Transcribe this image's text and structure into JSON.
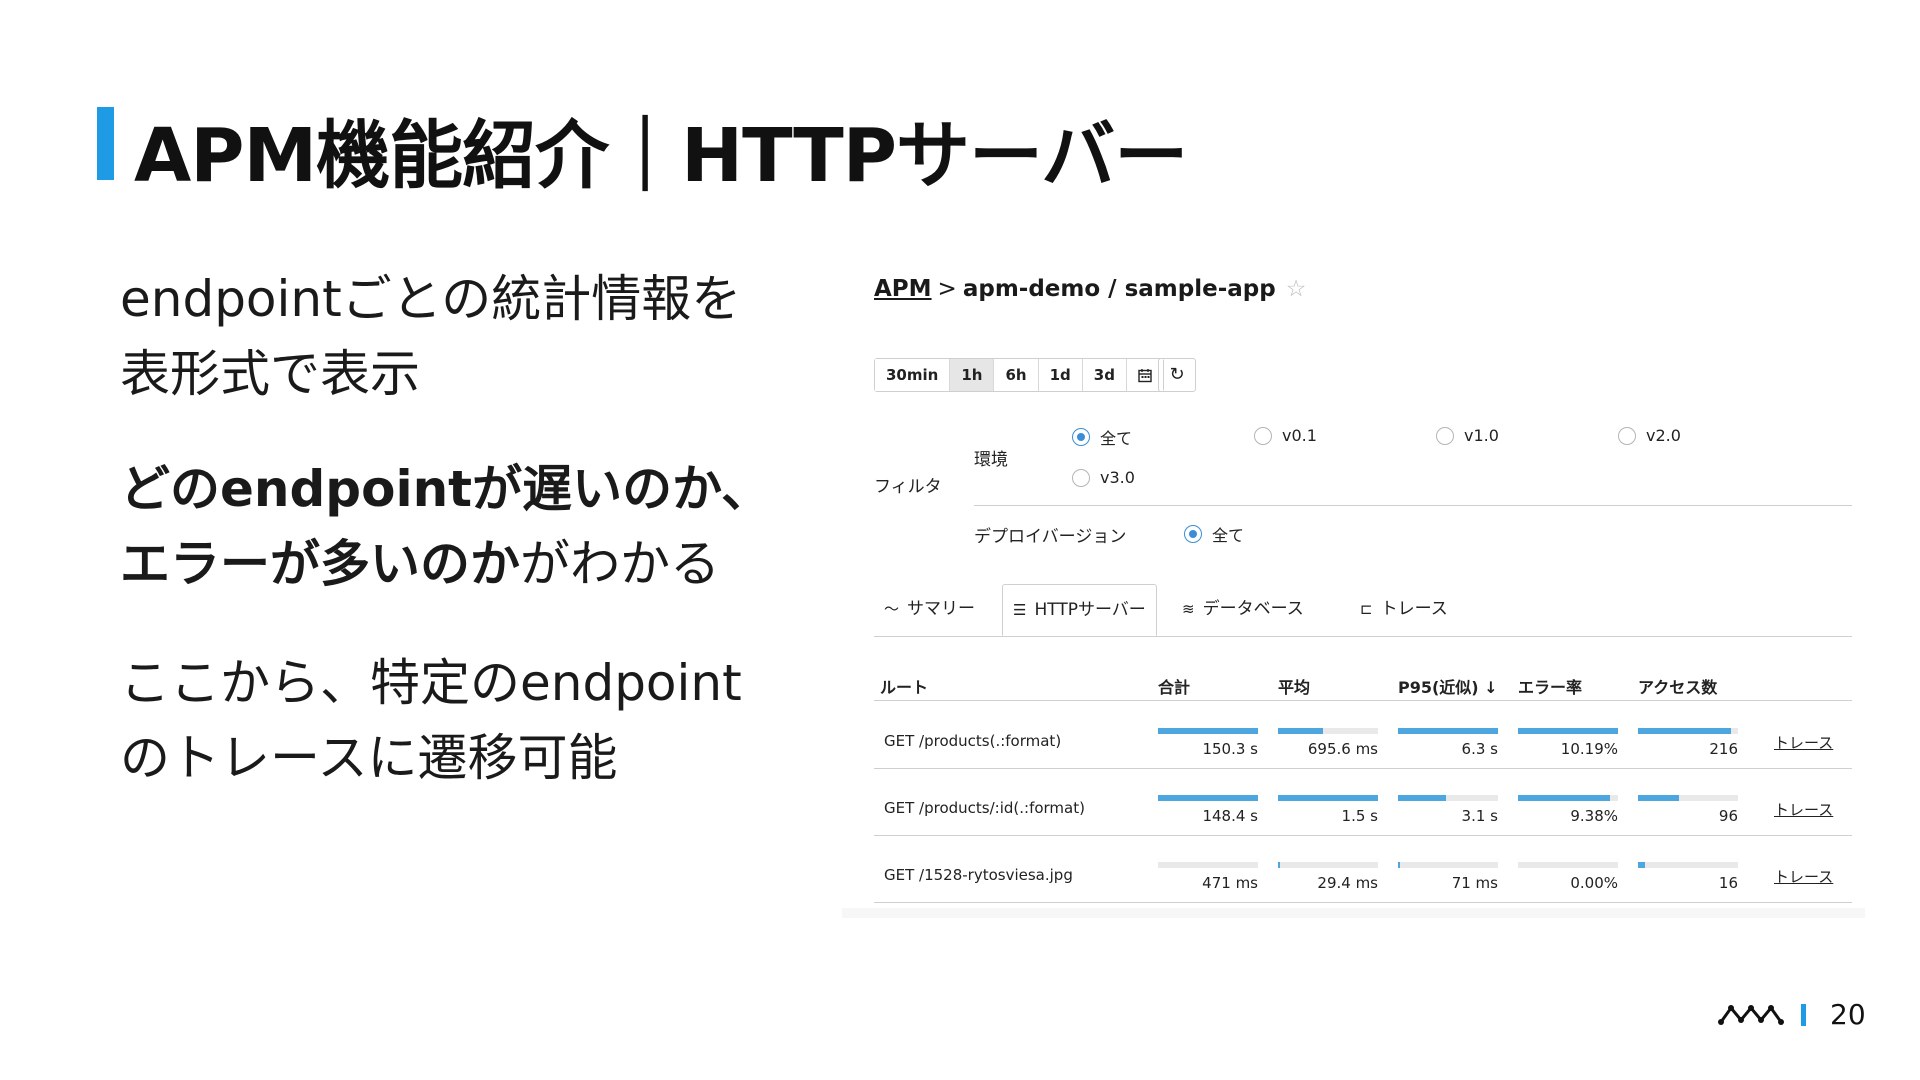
{
  "slide": {
    "title": "APM機能紹介｜HTTPサーバー",
    "page_number": "20",
    "accent_color": "#1e9be4"
  },
  "text": {
    "p1_line1": "endpointごとの統計情報を",
    "p1_line2": "表形式で表示",
    "p2_bold1": "どのendpointが遅いのか、",
    "p2_bold2": "エラーが多いのか",
    "p2_rest": "がわかる",
    "p3_line1": "ここから、特定のendpoint",
    "p3_line2": "のトレースに遷移可能"
  },
  "app": {
    "breadcrumb": {
      "root": "APM",
      "separator": ">",
      "path": "apm-demo / sample-app",
      "star_icon": "star-icon"
    },
    "time_buttons": [
      "30min",
      "1h",
      "6h",
      "1d",
      "3d"
    ],
    "active_time": "1h",
    "calendar_icon": "calendar-icon",
    "refresh_icon": "refresh-icon",
    "filter": {
      "label": "フィルタ",
      "env_label": "環境",
      "env_options": [
        "全て",
        "v0.1",
        "v1.0",
        "v2.0",
        "v3.0"
      ],
      "env_selected": "全て",
      "deploy_label": "デプロイバージョン",
      "deploy_options": [
        "全て"
      ],
      "deploy_selected": "全て"
    },
    "tabs": [
      {
        "label": "サマリー",
        "icon": "line-chart-icon"
      },
      {
        "label": "HTTPサーバー",
        "icon": "server-icon"
      },
      {
        "label": "データベース",
        "icon": "database-icon"
      },
      {
        "label": "トレース",
        "icon": "trace-icon"
      }
    ],
    "active_tab": "HTTPサーバー",
    "table": {
      "headers": [
        "ルート",
        "合計",
        "平均",
        "P95(近似) ↓",
        "エラー率",
        "アクセス数"
      ],
      "rows": [
        {
          "route": "GET /products(.:format)",
          "total": "150.3 s",
          "total_frac": 1.0,
          "avg": "695.6 ms",
          "avg_frac": 0.45,
          "p95": "6.3 s",
          "p95_frac": 1.0,
          "error": "10.19%",
          "error_frac": 1.0,
          "access": "216",
          "access_frac": 0.93,
          "link": "トレース"
        },
        {
          "route": "GET /products/:id(.:format)",
          "total": "148.4 s",
          "total_frac": 1.0,
          "avg": "1.5 s",
          "avg_frac": 1.0,
          "p95": "3.1 s",
          "p95_frac": 0.48,
          "error": "9.38%",
          "error_frac": 0.92,
          "access": "96",
          "access_frac": 0.41,
          "link": "トレース"
        },
        {
          "route": "GET /1528-rytosviesa.jpg",
          "total": "471 ms",
          "total_frac": 0.0,
          "avg": "29.4 ms",
          "avg_frac": 0.02,
          "p95": "71 ms",
          "p95_frac": 0.01,
          "error": "0.00%",
          "error_frac": 0.0,
          "access": "16",
          "access_frac": 0.07,
          "link": "トレース"
        }
      ]
    }
  }
}
